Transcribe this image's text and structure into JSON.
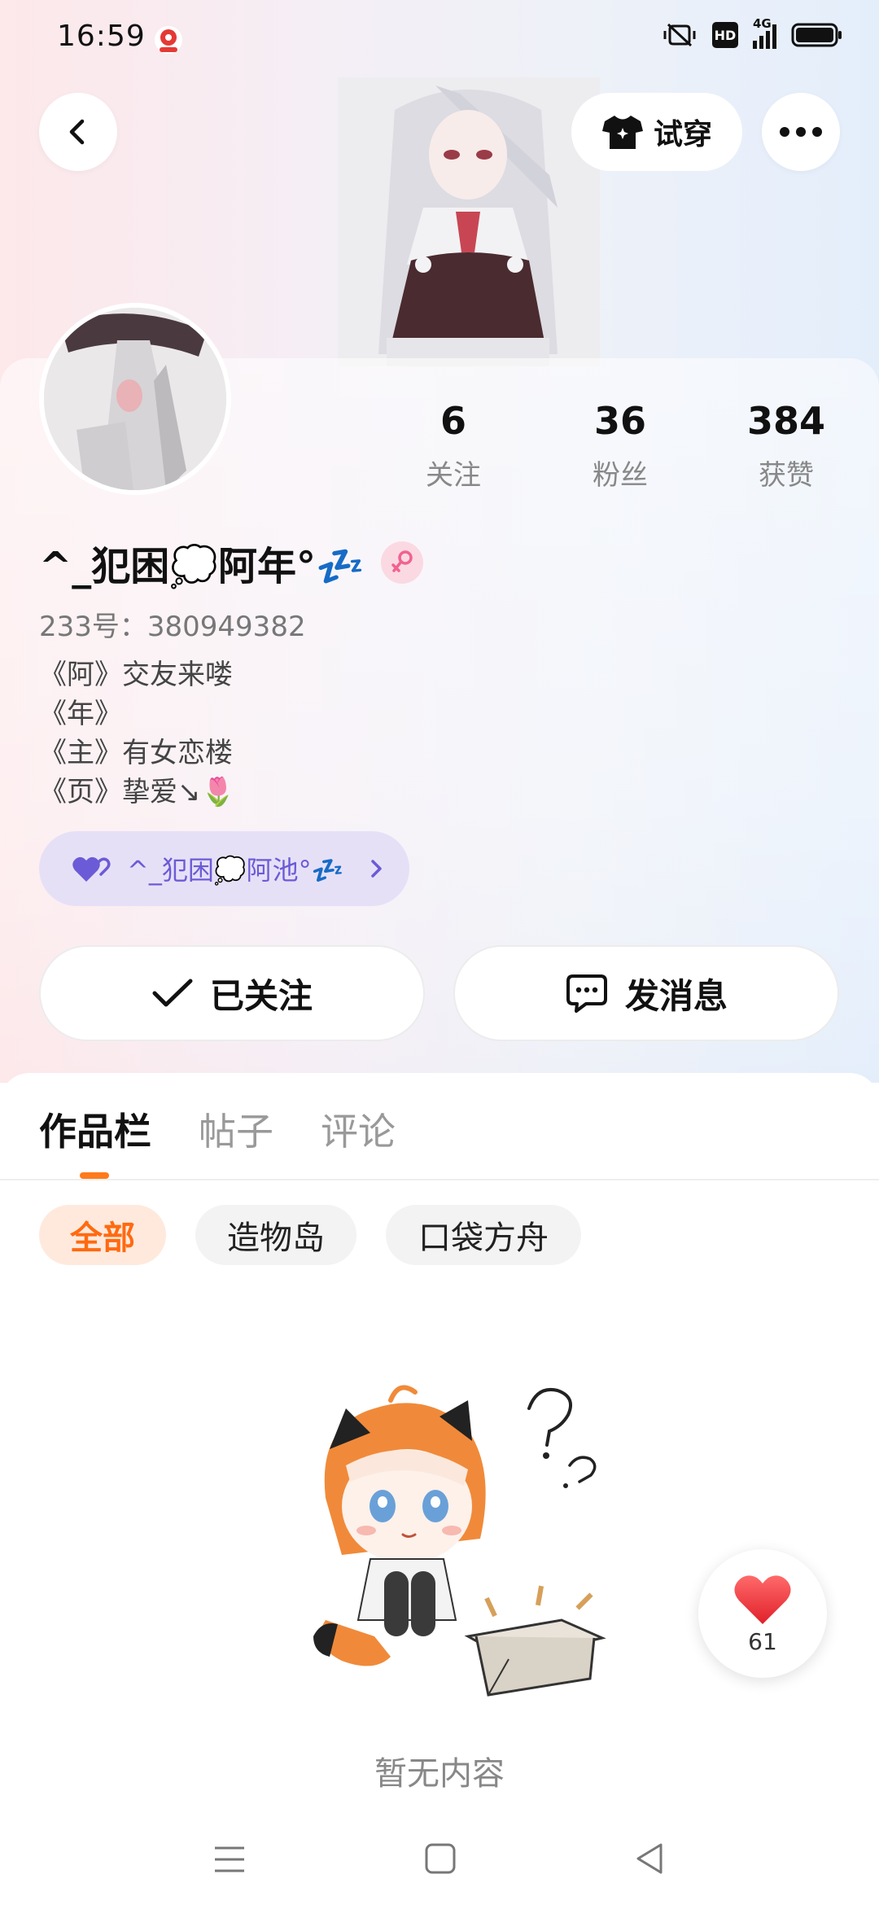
{
  "status_bar": {
    "time": "16:59",
    "hd_label": "HD",
    "network_label": "4G"
  },
  "header": {
    "tryon_label": "试穿"
  },
  "profile": {
    "stats": [
      {
        "value": "6",
        "label": "关注"
      },
      {
        "value": "36",
        "label": "粉丝"
      },
      {
        "value": "384",
        "label": "获赞"
      }
    ],
    "name": "^_犯困💭阿年°💤",
    "gender": "female",
    "uid": "233号：380949382",
    "bio_lines": [
      "《阿》交友来喽",
      "《年》",
      "《主》有女恋楼",
      "《页》挚爱↘🌷"
    ],
    "partner_label": "^_犯困💭阿池°💤"
  },
  "actions": {
    "follow_label": "已关注",
    "message_label": "发消息"
  },
  "tabs": [
    {
      "label": "作品栏",
      "active": true
    },
    {
      "label": "帖子",
      "active": false
    },
    {
      "label": "评论",
      "active": false
    }
  ],
  "filters": [
    {
      "label": "全部",
      "active": true
    },
    {
      "label": "造物岛",
      "active": false
    },
    {
      "label": "口袋方舟",
      "active": false
    }
  ],
  "empty_text": "暂无内容",
  "like_fab": {
    "count": "61"
  },
  "colors": {
    "accent": "#ff7a1a",
    "partner": "#6b5bd6",
    "heart": "#f03a3e"
  }
}
